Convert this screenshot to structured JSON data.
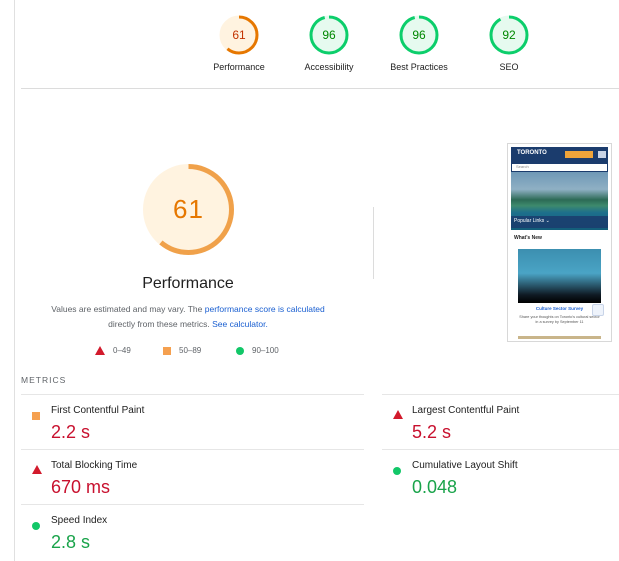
{
  "gauges": [
    {
      "score": "61",
      "label": "Performance",
      "color": "#e67700",
      "track": "#fff3e0",
      "value": 0.61
    },
    {
      "score": "96",
      "label": "Accessibility",
      "color": "#0cce6b",
      "track": "#e6faef",
      "value": 0.96
    },
    {
      "score": "96",
      "label": "Best Practices",
      "color": "#0cce6b",
      "track": "#e6faef",
      "value": 0.96
    },
    {
      "score": "92",
      "label": "SEO",
      "color": "#0cce6b",
      "track": "#e6faef",
      "value": 0.92
    }
  ],
  "main": {
    "score": "61",
    "score_value": 0.61,
    "title": "Performance",
    "desc_prefix": "Values are estimated and may vary. The ",
    "desc_link": "performance score is calculated",
    "desc_middle": "directly from these metrics. ",
    "desc_calc": "See calculator."
  },
  "legend": {
    "poor": "0–49",
    "average": "50–89",
    "good": "90–100"
  },
  "thumbnail": {
    "logo": "TORONTO",
    "search": "Search",
    "popular": "Popular Links ⌄",
    "news": "What's New",
    "caption": "Culture Sector Survey",
    "small": "Share your thoughts on Toronto's cultural sector in a survey by September 11"
  },
  "metrics": {
    "header": "METRICS",
    "items": [
      {
        "label": "First Contentful Paint",
        "value": "2.2 s",
        "rating": "average"
      },
      {
        "label": "Largest Contentful Paint",
        "value": "5.2 s",
        "rating": "poor"
      },
      {
        "label": "Total Blocking Time",
        "value": "670 ms",
        "rating": "poor"
      },
      {
        "label": "Cumulative Layout Shift",
        "value": "0.048",
        "rating": "good"
      },
      {
        "label": "Speed Index",
        "value": "2.8 s",
        "rating": "good"
      }
    ]
  },
  "colors": {
    "poor": "#d21a2c",
    "average": "#f5a04f",
    "good": "#12c768"
  }
}
